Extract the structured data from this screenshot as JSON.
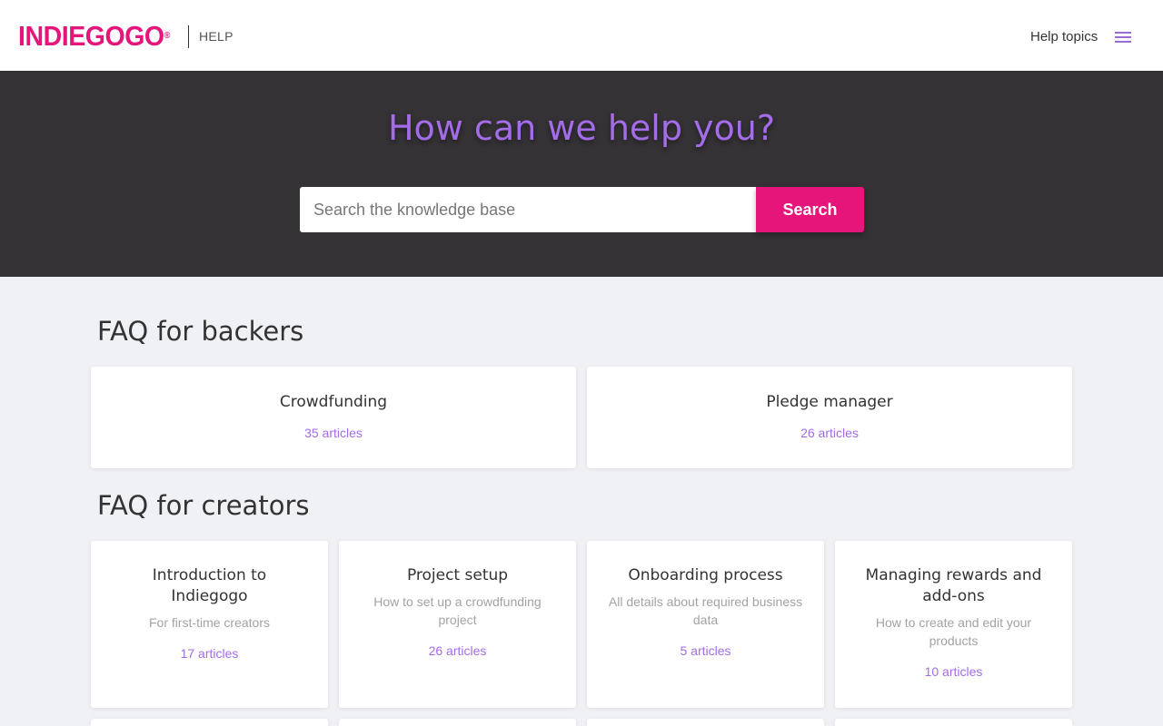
{
  "header": {
    "logo": "INDIEGOGO",
    "logo_mark": "®",
    "help_label": "HELP",
    "help_topics": "Help topics",
    "menu_icon": "hamburger-menu-icon"
  },
  "hero": {
    "title": "How can we help you?",
    "search_placeholder": "Search the knowledge base",
    "search_button": "Search"
  },
  "backers": {
    "title": "FAQ for backers",
    "cards": [
      {
        "title": "Crowdfunding",
        "count": "35 articles"
      },
      {
        "title": "Pledge manager",
        "count": "26 articles"
      }
    ]
  },
  "creators": {
    "title": "FAQ for creators",
    "cards": [
      {
        "title": "Introduction to Indiegogo",
        "desc": "For first-time creators",
        "count": "17 articles"
      },
      {
        "title": "Project setup",
        "desc": "How to set up a crowdfunding project",
        "count": "26 articles"
      },
      {
        "title": "Onboarding process",
        "desc": "All details about required business data",
        "count": "5 articles"
      },
      {
        "title": "Managing rewards and add-ons",
        "desc": "How to create and edit your products",
        "count": "10 articles"
      }
    ]
  },
  "colors": {
    "brand": "#e5157a",
    "accent": "#a36ce8",
    "hero_bg": "#353235",
    "page_bg": "#f0f1f5"
  }
}
